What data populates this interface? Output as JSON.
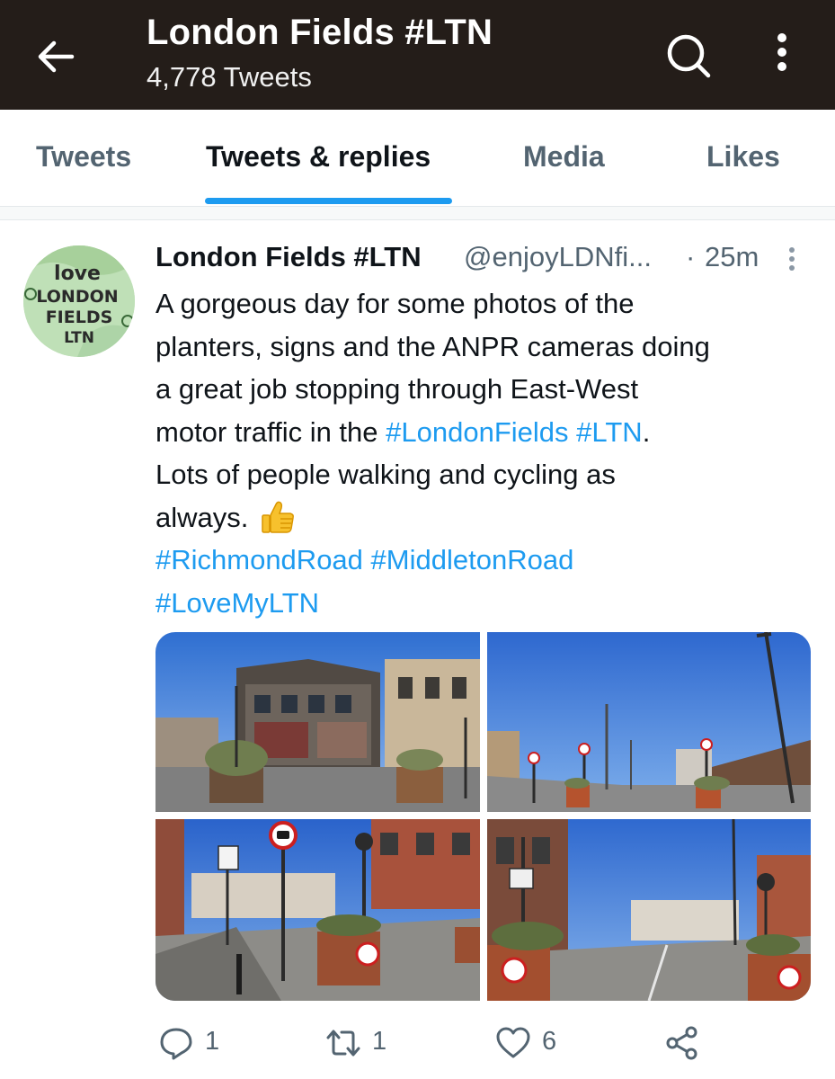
{
  "header": {
    "title": "London Fields #LTN",
    "subtitle": "4,778 Tweets",
    "back_icon": "arrow-left-icon",
    "search_icon": "search-icon",
    "more_icon": "more-vertical-icon"
  },
  "tabs": [
    {
      "label": "Tweets",
      "active": false
    },
    {
      "label": "Tweets & replies",
      "active": true
    },
    {
      "label": "Media",
      "active": false
    },
    {
      "label": "Likes",
      "active": false
    }
  ],
  "colors": {
    "header_bg": "#241d19",
    "accent": "#1d9bf0",
    "secondary_text": "#536471",
    "primary_text": "#0f1419"
  },
  "tweet": {
    "author_name": "London Fields #LTN",
    "author_handle": "@enjoyLDNfi...",
    "separator": "·",
    "timestamp": "25m",
    "avatar_text": {
      "line1": "love",
      "line2": "LONDON",
      "line3": "FIELDS",
      "line4": "LTN"
    },
    "text": {
      "line1": "A gorgeous day for some photos of the",
      "line2": "planters, signs and the ANPR cameras doing",
      "line3": "a great job stopping through East-West",
      "line4_prefix": "motor traffic in the ",
      "line4_tag1": "#LondonFields",
      "line4_space": " ",
      "line4_tag2": "#LTN",
      "line4_suffix": ".",
      "line5": "Lots of people walking and cycling as",
      "line6": "always. ",
      "line7_tag1": "#RichmondRoad",
      "line7_space": " ",
      "line7_tag2": "#MiddletonRoad",
      "line8_tag1": "#LoveMyLTN"
    },
    "emoji": "thumbs-up-icon",
    "photos": [
      {
        "name": "photo-pub-corner-planter"
      },
      {
        "name": "photo-street-planters-signs"
      },
      {
        "name": "photo-no-motor-vehicle-sign-pavement"
      },
      {
        "name": "photo-planters-anpr-camera"
      }
    ],
    "actions": {
      "reply_count": "1",
      "retweet_count": "1",
      "like_count": "6",
      "reply_icon": "reply-icon",
      "retweet_icon": "retweet-icon",
      "like_icon": "heart-icon",
      "share_icon": "share-icon"
    }
  }
}
